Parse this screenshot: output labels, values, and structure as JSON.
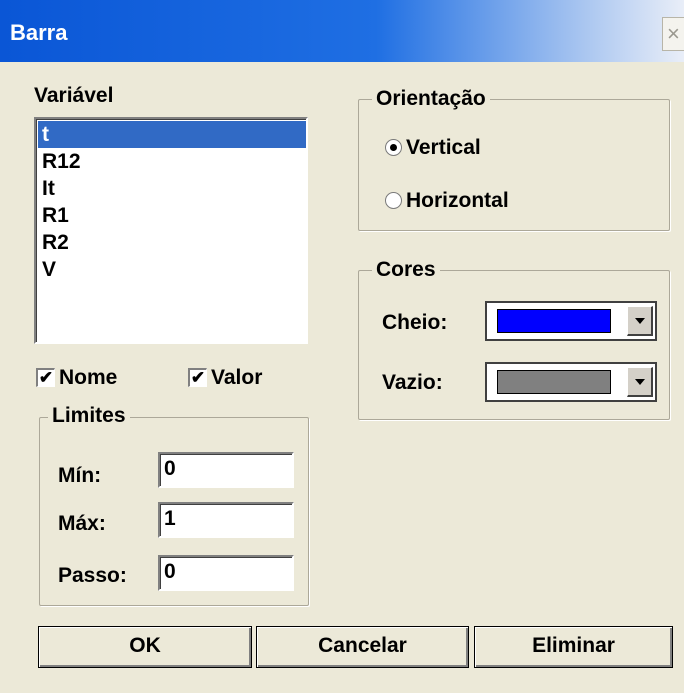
{
  "window": {
    "title": "Barra",
    "close_glyph": "×"
  },
  "variable": {
    "label": "Variável",
    "items": [
      {
        "label": "t",
        "selected": true
      },
      {
        "label": "R12",
        "selected": false
      },
      {
        "label": "It",
        "selected": false
      },
      {
        "label": "R1",
        "selected": false
      },
      {
        "label": "R2",
        "selected": false
      },
      {
        "label": "V",
        "selected": false
      }
    ]
  },
  "checkboxes": {
    "nome": {
      "label": "Nome",
      "checked": true
    },
    "valor": {
      "label": "Valor",
      "checked": true
    },
    "check_glyph": "✔"
  },
  "limits": {
    "title": "Limites",
    "min_label": "Mín:",
    "min_value": "0",
    "max_label": "Máx:",
    "max_value": "1",
    "step_label": "Passo:",
    "step_value": "0"
  },
  "orientation": {
    "title": "Orientação",
    "vertical": {
      "label": "Vertical",
      "checked": true
    },
    "horizontal": {
      "label": "Horizontal",
      "checked": false
    }
  },
  "colors": {
    "title": "Cores",
    "filled_label": "Cheio:",
    "filled_color": "#0000ff",
    "empty_label": "Vazio:",
    "empty_color": "#808080"
  },
  "buttons": {
    "ok": "OK",
    "cancel": "Cancelar",
    "delete": "Eliminar"
  }
}
